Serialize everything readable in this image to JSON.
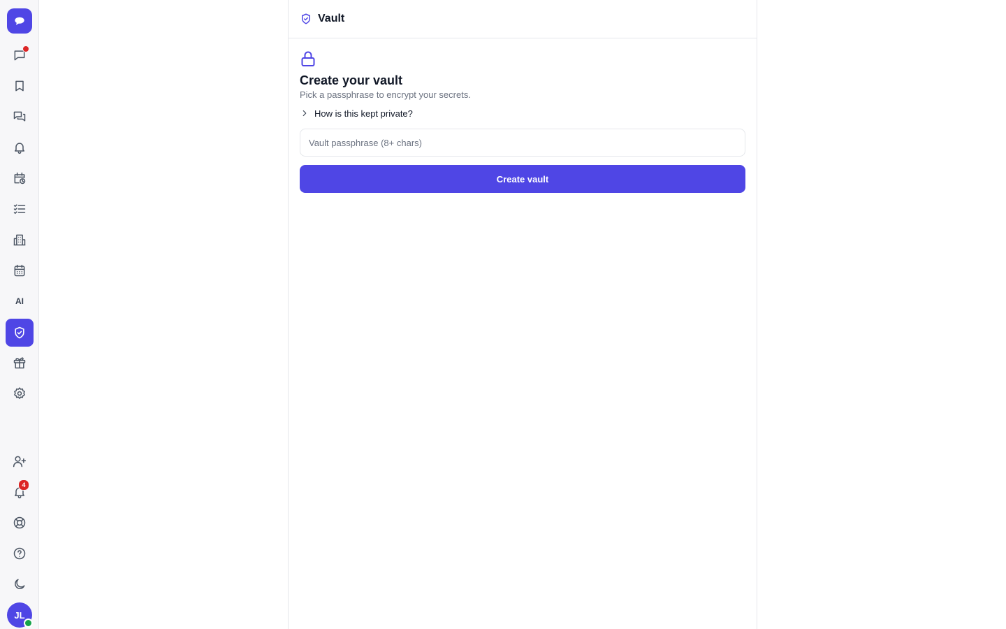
{
  "sidebar": {
    "logo_icon": "chat-bubble-icon",
    "items": [
      {
        "name": "messages",
        "icon": "message-square-icon",
        "has_dot": true
      },
      {
        "name": "bookmarks",
        "icon": "bookmark-icon"
      },
      {
        "name": "threads",
        "icon": "chats-icon"
      },
      {
        "name": "notifications",
        "icon": "bell-icon"
      },
      {
        "name": "scheduled",
        "icon": "calendar-clock-icon"
      },
      {
        "name": "tasks",
        "icon": "checklist-icon"
      },
      {
        "name": "directory",
        "icon": "building-icon"
      },
      {
        "name": "calendar",
        "icon": "calendar-icon"
      },
      {
        "name": "ai",
        "label": "AI"
      },
      {
        "name": "vault",
        "icon": "shield-check-icon",
        "active": true
      },
      {
        "name": "gifts",
        "icon": "gift-icon"
      },
      {
        "name": "settings",
        "icon": "gear-icon"
      }
    ],
    "bottom": {
      "invite_icon": "user-plus-icon",
      "notifications_count": "4",
      "support_icon": "lifebuoy-icon",
      "help_icon": "help-circle-icon",
      "theme_icon": "moon-icon",
      "avatar_initials": "JL",
      "avatar_status": "online"
    }
  },
  "header": {
    "icon": "shield-check-icon",
    "title": "Vault"
  },
  "vault_setup": {
    "icon": "lock-icon",
    "heading": "Create your vault",
    "subtitle": "Pick a passphrase to encrypt your secrets.",
    "disclosure_label": "How is this kept private?",
    "passphrase_placeholder": "Vault passphrase (8+ chars)",
    "passphrase_value": "",
    "submit_label": "Create vault"
  },
  "colors": {
    "accent": "#4f46e5",
    "badge": "#dc2626",
    "online": "#16a34a"
  }
}
